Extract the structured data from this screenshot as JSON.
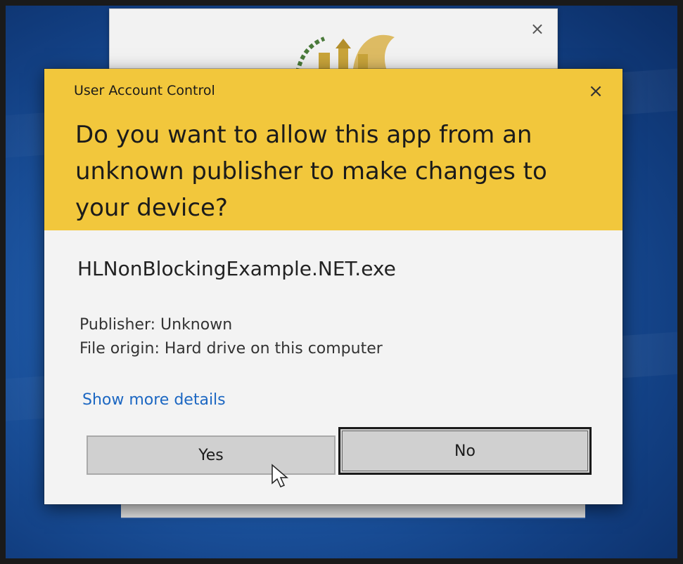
{
  "background_window": {
    "close_glyph": "×"
  },
  "dialog": {
    "title": "User Account Control",
    "close_glyph": "×",
    "question": "Do you want to allow this app from an unknown publisher to make changes to your device?",
    "app_name": "HLNonBlockingExample.NET.exe",
    "publisher": "Publisher: Unknown",
    "file_origin": "File origin: Hard drive on this computer",
    "details_link": "Show more details",
    "yes_label": "Yes",
    "no_label": "No"
  },
  "colors": {
    "header_bg": "#f2c73c",
    "dialog_bg": "#f3f3f3",
    "link": "#1c67c2",
    "button_bg": "#d0d0d0",
    "desktop_blue": "#1f5aa8"
  }
}
